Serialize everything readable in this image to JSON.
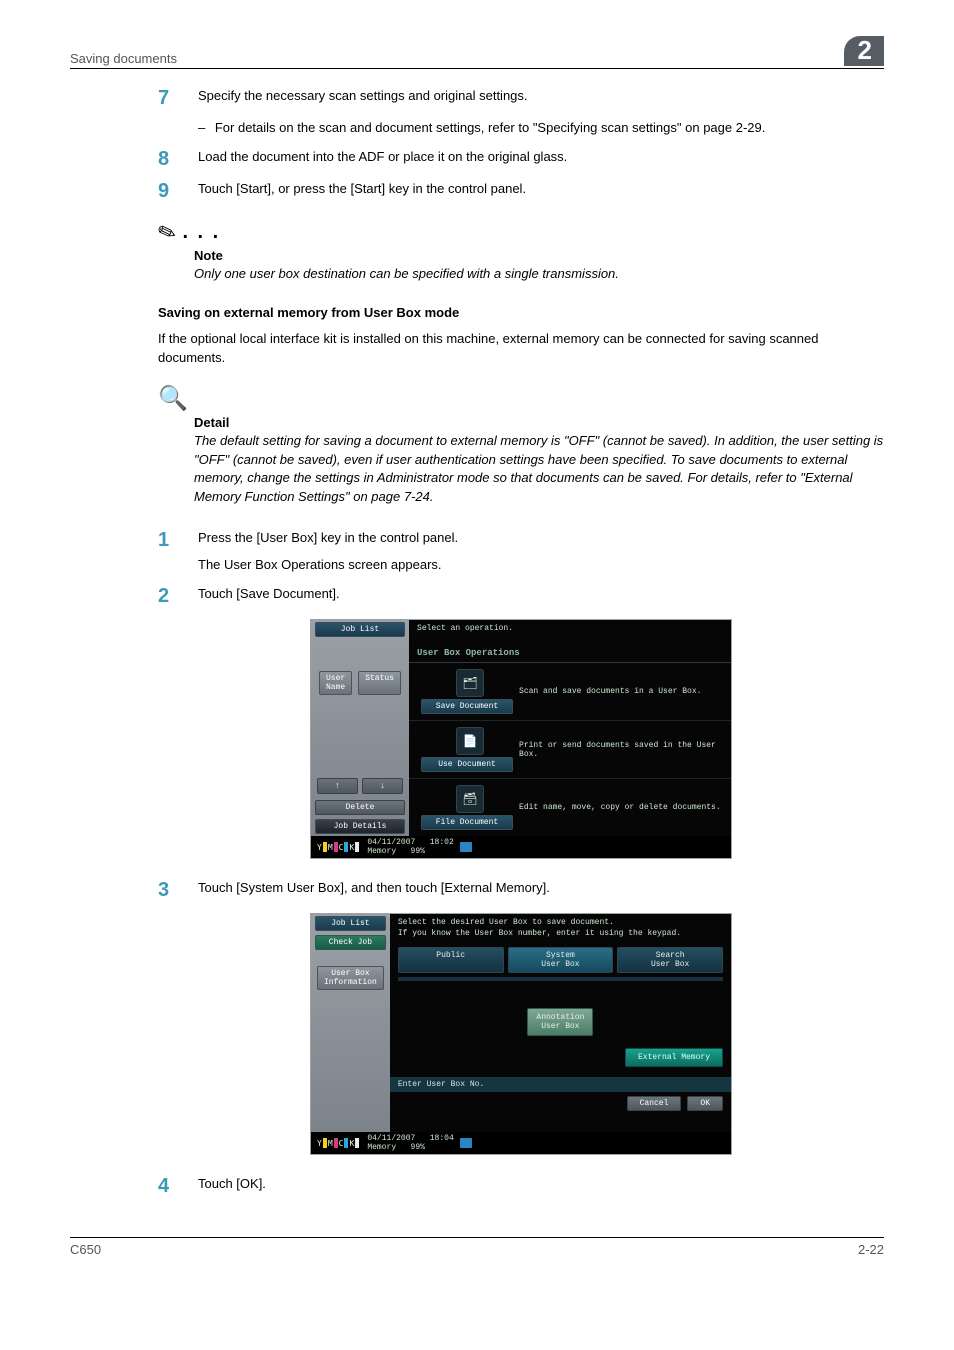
{
  "header": {
    "section": "Saving documents",
    "chapter_badge": "2"
  },
  "steps_a": {
    "s7": {
      "num": "7",
      "text": "Specify the necessary scan settings and original settings.",
      "sub": "For details on the scan and document settings, refer to \"Specifying scan settings\" on page 2-29."
    },
    "s8": {
      "num": "8",
      "text": "Load the document into the ADF or place it on the original glass."
    },
    "s9": {
      "num": "9",
      "text": "Touch [Start], or press the [Start] key in the control panel."
    }
  },
  "note": {
    "label": "Note",
    "body": "Only one user box destination can be specified with a single transmission."
  },
  "section": {
    "title": "Saving on external memory from User Box mode",
    "body": "If the optional local interface kit is installed on this machine, external memory can be connected for saving scanned documents."
  },
  "detail": {
    "label": "Detail",
    "body": "The default setting for saving a document to external memory is \"OFF\" (cannot be saved). In addition, the user setting is \"OFF\" (cannot be saved), even if user authentication settings have been specified. To save documents to external memory, change the settings in Administrator mode so that documents can be saved. For details, refer to \"External Memory Function Settings\" on page 7-24."
  },
  "steps_b": {
    "s1": {
      "num": "1",
      "text": "Press the [User Box] key in the control panel.",
      "text2": "The User Box Operations screen appears."
    },
    "s2": {
      "num": "2",
      "text": "Touch [Save Document]."
    },
    "s3": {
      "num": "3",
      "text": "Touch [System User Box], and then touch [External Memory]."
    },
    "s4": {
      "num": "4",
      "text": "Touch [OK]."
    }
  },
  "panel1": {
    "left": {
      "job_list": "Job List",
      "user_name": "User\nName",
      "status": "Status",
      "arrow_up": "↑",
      "arrow_down": "↓",
      "delete": "Delete",
      "job_details": "Job Details"
    },
    "main": {
      "prompt": "Select an operation.",
      "subheader": "User Box Operations",
      "ops": {
        "save": {
          "btn": "Save Document",
          "desc": "Scan and save documents in a User Box."
        },
        "use": {
          "btn": "Use Document",
          "desc": "Print or send documents saved in the User Box."
        },
        "file": {
          "btn": "File Document",
          "desc": "Edit name, move, copy or delete documents."
        }
      }
    },
    "status": {
      "date": "04/11/2007",
      "time": "18:02",
      "memory": "Memory",
      "memval": "99%"
    }
  },
  "panel2": {
    "left": {
      "job_list": "Job List",
      "check_job": "Check Job",
      "user_box_info": "User Box\nInformation"
    },
    "main": {
      "prompt1": "Select the desired User Box to save document.",
      "prompt2": "If you know the User Box number, enter it using the keypad.",
      "tabs": {
        "public": "Public",
        "system": "System\nUser Box",
        "search": "Search\nUser Box"
      },
      "annotation": "Annotation\nUser Box",
      "external": "External Memory",
      "enter": "Enter User Box No.",
      "cancel": "Cancel",
      "ok": "OK"
    },
    "status": {
      "date": "04/11/2007",
      "time": "18:04",
      "memory": "Memory",
      "memval": "99%"
    }
  },
  "footer": {
    "left": "C650",
    "right": "2-22"
  }
}
